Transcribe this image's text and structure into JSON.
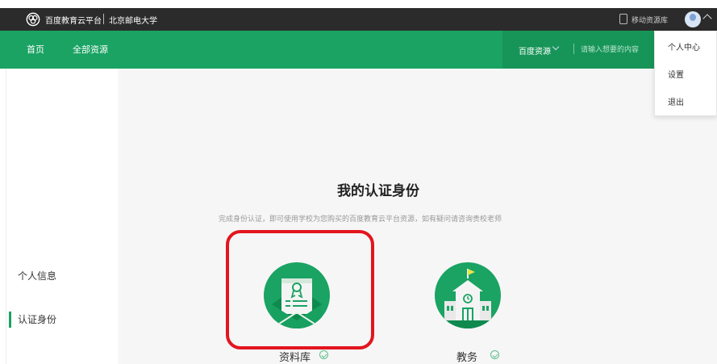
{
  "topbar": {
    "platform_name": "百度教育云平台",
    "school_name": "北京邮电大学",
    "mobile_label": "移动资源库",
    "icons": [
      "baidu-edu-logo-icon",
      "mobile-phone-icon",
      "avatar",
      "chevron-up-icon"
    ]
  },
  "nav": {
    "home": "首页",
    "all_resources": "全部资源",
    "source_select": "百度资源",
    "search_placeholder": "请输入想要的内容"
  },
  "dropdown": {
    "items": [
      "个人中心",
      "设置",
      "退出"
    ]
  },
  "sidebar": {
    "items": [
      "个人信息",
      "认证身份"
    ],
    "active_index": 1
  },
  "main": {
    "title": "我的认证身份",
    "subtitle": "完成身份认证，即可使用学校为您购买的百度教育云平台资源，如有疑问请咨询贵校老师",
    "cards": [
      {
        "label": "资料库",
        "icon": "certificate-envelope-icon",
        "verified": true,
        "highlighted": true
      },
      {
        "label": "教务",
        "icon": "school-building-icon",
        "verified": true,
        "highlighted": false
      }
    ]
  },
  "colors": {
    "brand_green": "#1aa363",
    "highlight_red": "#e3151e",
    "topbar_dark": "#2b2b2b"
  }
}
